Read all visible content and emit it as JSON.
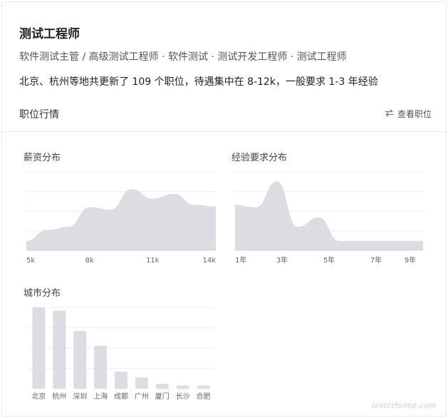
{
  "job": {
    "title": "测试工程师",
    "tags": "软件测试主管 / 高级测试工程师 · 软件测试 · 测试开发工程师 · 测试工程师",
    "summary": "北京、杭州等地共更新了 109 个职位，待遇集中在 8-12k，一般要求 1-3 年经验"
  },
  "section": {
    "title": "职位行情",
    "view_label": "查看职位",
    "view_icon": "swap-arrows-icon"
  },
  "watermark": "testerhome.com",
  "colors": {
    "fill": "#dcdce2",
    "grid": "#efefef",
    "axis": "#d8d8d8"
  },
  "chart_data": [
    {
      "type": "area",
      "title": "薪资分布",
      "x": [
        5,
        6,
        7,
        8,
        9,
        10,
        11,
        12,
        13,
        14
      ],
      "values": [
        12,
        26,
        30,
        55,
        52,
        78,
        66,
        72,
        58,
        56
      ],
      "xticks": [
        "5k",
        "8k",
        "11k",
        "14k"
      ],
      "ylim": [
        0,
        100
      ],
      "grid": true
    },
    {
      "type": "area",
      "title": "经验要求分布",
      "x": [
        1,
        2,
        3,
        4,
        5,
        6,
        7,
        8,
        9,
        10
      ],
      "values": [
        58,
        55,
        88,
        30,
        42,
        12,
        12,
        12,
        12,
        12
      ],
      "xticks": [
        "1年",
        "3年",
        "5年",
        "7年",
        "9年"
      ],
      "ylim": [
        0,
        100
      ],
      "grid": true
    },
    {
      "type": "bar",
      "title": "城市分布",
      "categories": [
        "北京",
        "杭州",
        "深圳",
        "上海",
        "成都",
        "广州",
        "厦门",
        "长沙",
        "合肥"
      ],
      "values": [
        100,
        96,
        71,
        53,
        21,
        14,
        6,
        4,
        4
      ],
      "ylim": [
        0,
        100
      ],
      "grid": true
    }
  ]
}
